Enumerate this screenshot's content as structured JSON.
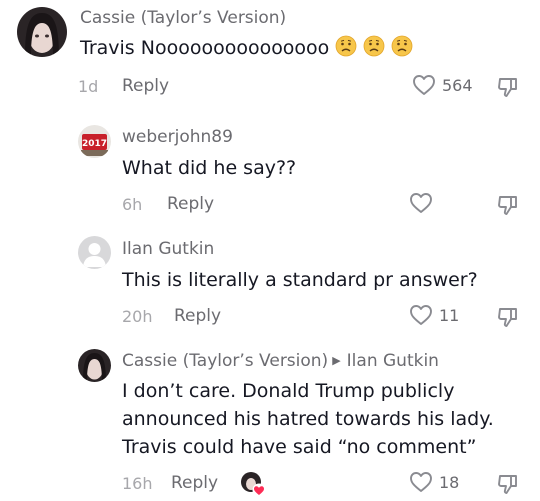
{
  "comments": [
    {
      "author": "Cassie (Taylor’s Version)",
      "text": "Travis Nooooooooooooooo",
      "emoji_count": 3,
      "emoji_icon": "worried-face-icon",
      "time": "1d",
      "reply_label": "Reply",
      "like_count": "564"
    },
    {
      "author": "weberjohn89",
      "text": "What did he say??",
      "time": "6h",
      "reply_label": "Reply",
      "like_count": ""
    },
    {
      "author": "Ilan Gutkin",
      "text": "This is literally a standard pr answer?",
      "time": "20h",
      "reply_label": "Reply",
      "like_count": "11"
    },
    {
      "author": "Cassie (Taylor’s Version)",
      "reply_to": "Ilan Gutkin",
      "text_lines": [
        "I don’t care. Donald Trump publicly",
        "announced his hatred towards his lady.",
        "Travis could have said “no comment”"
      ],
      "time": "16h",
      "reply_label": "Reply",
      "like_count": "18",
      "creator_liked_icon": "creator-liked-heart-icon"
    }
  ],
  "colors": {
    "primary_text": "#161823",
    "secondary_text": "#6b6b70",
    "muted_text": "#a7a7ab",
    "heart_badge": "#fe2c55"
  }
}
